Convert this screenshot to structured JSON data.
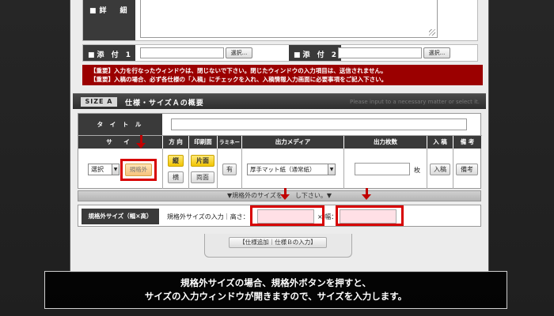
{
  "detail": {
    "label": "■詳　細"
  },
  "attachments": [
    {
      "label": "■添 付 1",
      "button": "選択..."
    },
    {
      "label": "■添 付 2",
      "button": "選択..."
    }
  ],
  "notice": {
    "line1": "【重要】入力を行なったウィンドウは、閉じないで下さい。閉じたウィンドウの入力項目は、送信されません。",
    "line2": "【重要】入稿の場合、必ず各仕様の「入稿」にチェックを入れ、入稿情報入力画面に必要事項をご記入下さい。"
  },
  "size_section": {
    "badge": "SIZE A",
    "title": "仕様・サイズＡの概要",
    "hint": "Please input to a necessary matter or select it."
  },
  "table": {
    "title_label": "タ イ ト ル",
    "headers": {
      "size": "サ イ",
      "direction": "方 向",
      "print_side": "印刷面",
      "laminate": "ラミネート",
      "media": "出力メディア",
      "quantity": "出力枚数",
      "submit": "入 稿",
      "notes": "備 考"
    },
    "size_select": "選択",
    "custom_size_button": "規格外",
    "direction_options": [
      "縦",
      "横"
    ],
    "print_options": [
      "片面",
      "両面"
    ],
    "laminate_button": "有",
    "media_select": "厚手マット紙（通常紙）",
    "quantity_unit": "枚",
    "submit_button": "入稿",
    "notes_button": "備考"
  },
  "toggle_bar": "▼規格外のサイズを　　し下さい。▼",
  "custom_size": {
    "label": "規格外サイズ（幅×高）",
    "prompt": "規格外サイズの入力｜高さ：",
    "times": "× 幅："
  },
  "add_button": "【仕様追加｜仕様Ｂの入力】",
  "caption": {
    "line1": "規格外サイズの場合、規格外ボタンを押すと、",
    "line2": "サイズの入力ウィンドウが開きますので、サイズを入力します。"
  }
}
